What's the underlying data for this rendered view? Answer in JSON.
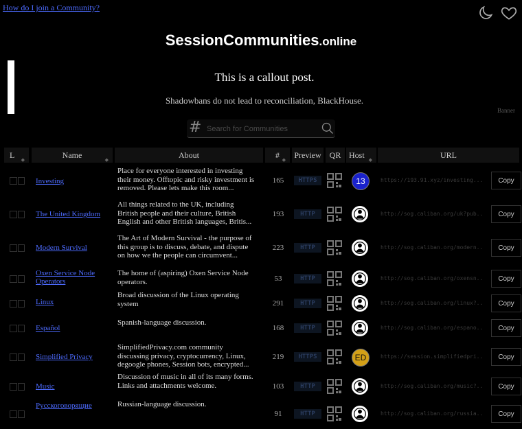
{
  "header": {
    "help_link": "How do I join a Community?",
    "title_main": "SessionCommunities",
    "title_suffix": ".online"
  },
  "callout": {
    "title": "This is a callout post.",
    "text": "Shadowbans do not lead to reconciliation, BlackHouse.",
    "banner_label": "Banner"
  },
  "search": {
    "placeholder": "Search for Communities"
  },
  "table": {
    "headers": {
      "lang": "L",
      "name": "Name",
      "about": "About",
      "users": "#",
      "preview": "Preview",
      "qr": "QR",
      "host": "Host",
      "url": "URL"
    },
    "copy_label": "Copy",
    "rows": [
      {
        "name": "Investing",
        "about": "Place for everyone interested in investing their money. Offtopic and risky investment is removed. Please lets make this room...",
        "users": "165",
        "preview": "HTTPS",
        "host": "13",
        "host_color": "#1a22cc",
        "url": "https://193.91.xyz/investing..."
      },
      {
        "name": "The United Kingdom",
        "about": "All things related to the UK, including British people and their culture, British English and other British languages, Britis...",
        "users": "193",
        "preview": "HTTP",
        "host": "",
        "host_color": "#ffffff",
        "url": "http://sog.caliban.org/uk?pub..."
      },
      {
        "name": "Modern Survival",
        "about": "The Art of Modern Survival - the purpose of this group is to discuss, debate, and dispute on how we the people can circumvent...",
        "users": "223",
        "preview": "HTTP",
        "host": "",
        "host_color": "#ffffff",
        "url": "http://sog.caliban.org/modern..."
      },
      {
        "name": "Oxen Service Node Operators",
        "about": "The home of (aspiring) Oxen Service Node operators.",
        "users": "53",
        "preview": "HTTP",
        "host": "",
        "host_color": "#ffffff",
        "url": "http://sog.caliban.org/oxensn..."
      },
      {
        "name": "Linux",
        "about": "Broad discussion of the Linux operating system",
        "users": "291",
        "preview": "HTTP",
        "host": "",
        "host_color": "#ffffff",
        "url": "http://sog.caliban.org/linux?..."
      },
      {
        "name": "Español",
        "about": "Spanish-language discussion.",
        "users": "168",
        "preview": "HTTP",
        "host": "",
        "host_color": "#ffffff",
        "url": "http://sog.caliban.org/espano..."
      },
      {
        "name": "Simplified Privacy",
        "about": "SimplifiedPrivacy.com community discussing privacy, cryptocurrency, Linux, degoogle phones, Session bots, encrypted...",
        "users": "219",
        "preview": "HTTPS",
        "host": "ED",
        "host_color": "#d4a017",
        "url": "https://session.simplifiedpri..."
      },
      {
        "name": "Music",
        "about": "Discussion of music in all of its many forms. Links and attachments welcome.",
        "users": "103",
        "preview": "HTTP",
        "host": "",
        "host_color": "#ffffff",
        "url": "http://sog.caliban.org/music?..."
      },
      {
        "name": "Русскоговорящие",
        "about": "Russian-language discussion.",
        "users": "91",
        "preview": "HTTP",
        "host": "",
        "host_color": "#ffffff",
        "url": "http://sog.caliban.org/russia..."
      }
    ]
  }
}
